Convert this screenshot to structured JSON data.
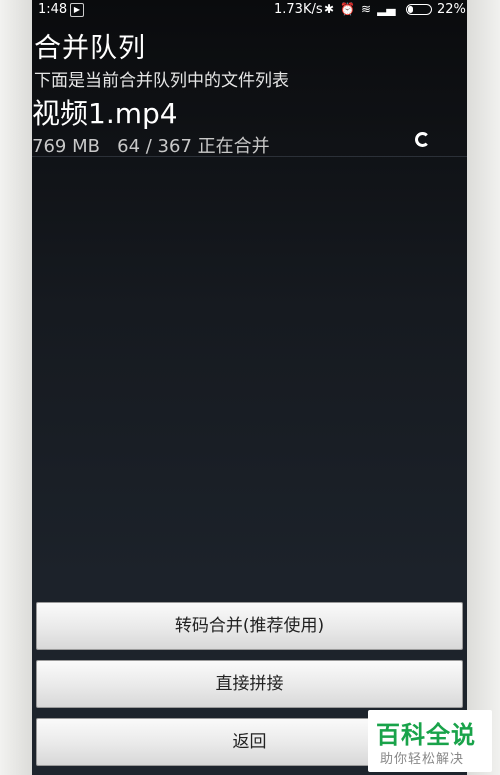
{
  "status_bar": {
    "time": "1:48",
    "net_speed": "1.73K/s",
    "battery_pct": "22%",
    "battery_level": 0.22,
    "icons": [
      "app-notification-icon",
      "bluetooth-icon",
      "alarm-icon",
      "wifi-icon",
      "signal-icon",
      "battery-icon"
    ]
  },
  "header": {
    "title": "合并队列",
    "subtitle": "下面是当前合并队列中的文件列表"
  },
  "queue": [
    {
      "name": "视频1.mp4",
      "meta": "769 MB   64 / 367 正在合并"
    }
  ],
  "buttons": {
    "transcode": "转码合并(推荐使用)",
    "direct": "直接拼接",
    "back": "返回"
  },
  "watermark": {
    "title": "百科全说",
    "subtitle": "助你轻松解决"
  }
}
